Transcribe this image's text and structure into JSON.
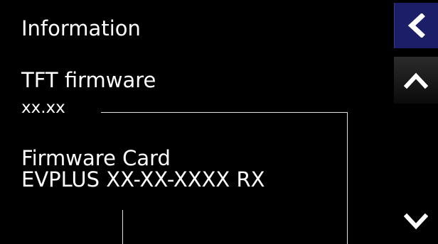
{
  "header": {
    "title": "Information"
  },
  "tft_firmware": {
    "label": "TFT firmware",
    "value": "xx.xx"
  },
  "firmware_card": {
    "label": "Firmware Card",
    "value": "EVPLUS XX-XX-XXXX RX"
  },
  "nav": {
    "back_icon": "chevron-left-icon",
    "up_icon": "chevron-up-icon",
    "down_icon": "chevron-down-icon"
  },
  "colors": {
    "background": "#000000",
    "text": "#ffffff",
    "back_button": "#1d1e68"
  }
}
